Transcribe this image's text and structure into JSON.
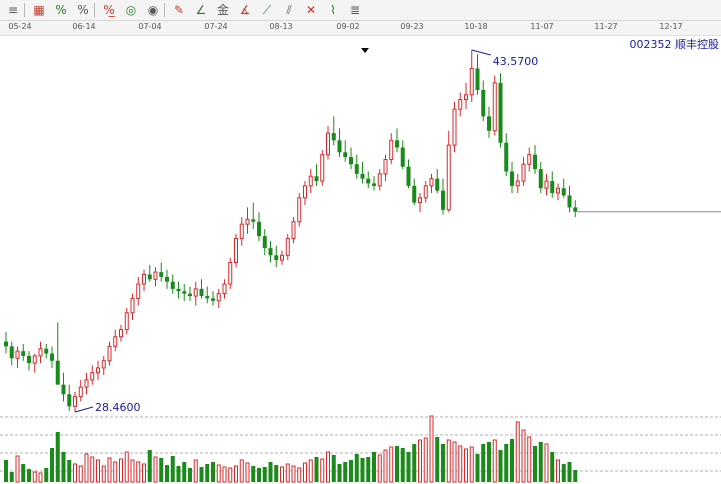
{
  "toolbar": {
    "icons": [
      "menu-lines-icon",
      "bar-table-icon",
      "percent-slash-icon",
      "percent-icon",
      "percent-line-icon",
      "coin-icon",
      "coin-line-icon",
      "pen-arrow-icon",
      "line-slope-icon",
      "gold-icon",
      "angle-line-icon",
      "fan-line-icon",
      "parallel-line-icon",
      "cross-line-icon",
      "stair-icon",
      "block-line-icon"
    ],
    "labels": [
      "≡",
      "▦",
      "%",
      "%",
      "%̲",
      "◎",
      "◉",
      "✎",
      "∠",
      "金",
      "∡",
      "⟋",
      "⫽",
      "✕",
      "⌇",
      "≣"
    ]
  },
  "stock_label": "002352 顺丰控股",
  "chart_data": {
    "type": "candlestick",
    "x_axis_ticks": [
      "05-24",
      "06-14",
      "07-04",
      "07-24",
      "08-13",
      "09-02",
      "09-23",
      "10-18",
      "11-07",
      "11-27",
      "12-17"
    ],
    "annotations": {
      "high_label": "43.5700",
      "low_label": "28.4600"
    },
    "last_close": 36.82,
    "candles": [
      [
        31.4,
        31.8,
        30.9,
        31.2
      ],
      [
        31.2,
        31.4,
        30.4,
        30.7
      ],
      [
        30.7,
        31.2,
        30.3,
        31.0
      ],
      [
        31.0,
        31.3,
        30.6,
        30.8
      ],
      [
        30.8,
        31.0,
        30.2,
        30.5
      ],
      [
        30.5,
        30.9,
        30.1,
        30.8
      ],
      [
        30.8,
        31.4,
        30.5,
        31.1
      ],
      [
        31.1,
        31.3,
        30.7,
        30.9
      ],
      [
        30.9,
        31.2,
        30.3,
        30.6
      ],
      [
        30.6,
        32.2,
        30.4,
        29.6
      ],
      [
        29.6,
        30.1,
        28.9,
        29.2
      ],
      [
        29.2,
        29.6,
        28.5,
        28.7
      ],
      [
        28.7,
        29.3,
        28.46,
        29.1
      ],
      [
        29.1,
        29.8,
        28.9,
        29.5
      ],
      [
        29.5,
        30.1,
        29.2,
        29.8
      ],
      [
        29.8,
        30.4,
        29.6,
        30.1
      ],
      [
        30.1,
        30.6,
        29.8,
        30.3
      ],
      [
        30.3,
        30.8,
        30.0,
        30.6
      ],
      [
        30.6,
        31.4,
        30.4,
        31.2
      ],
      [
        31.2,
        31.9,
        31.0,
        31.6
      ],
      [
        31.6,
        32.1,
        31.4,
        31.9
      ],
      [
        31.9,
        32.8,
        31.7,
        32.6
      ],
      [
        32.6,
        33.4,
        32.3,
        33.2
      ],
      [
        33.2,
        34.1,
        32.9,
        33.8
      ],
      [
        33.8,
        34.4,
        33.5,
        34.2
      ],
      [
        34.2,
        34.6,
        33.9,
        34.0
      ],
      [
        34.0,
        34.5,
        33.7,
        34.3
      ],
      [
        34.3,
        34.7,
        33.9,
        34.1
      ],
      [
        34.1,
        34.4,
        33.6,
        33.9
      ],
      [
        33.9,
        34.2,
        33.4,
        33.6
      ],
      [
        33.6,
        33.9,
        33.2,
        33.5
      ],
      [
        33.5,
        33.8,
        33.1,
        33.4
      ],
      [
        33.4,
        33.7,
        33.1,
        33.3
      ],
      [
        33.3,
        33.9,
        32.9,
        33.6
      ],
      [
        33.6,
        34.0,
        33.2,
        33.3
      ],
      [
        33.3,
        33.7,
        33.0,
        33.2
      ],
      [
        33.2,
        33.5,
        32.9,
        33.1
      ],
      [
        33.1,
        33.6,
        32.8,
        33.4
      ],
      [
        33.4,
        34.0,
        33.2,
        33.8
      ],
      [
        33.8,
        34.9,
        33.6,
        34.7
      ],
      [
        34.7,
        35.9,
        34.5,
        35.7
      ],
      [
        35.7,
        36.6,
        35.4,
        36.3
      ],
      [
        36.3,
        37.0,
        35.9,
        36.5
      ],
      [
        36.5,
        37.2,
        36.1,
        36.4
      ],
      [
        36.4,
        36.8,
        35.6,
        35.8
      ],
      [
        35.8,
        36.1,
        35.0,
        35.3
      ],
      [
        35.3,
        35.6,
        34.7,
        35.0
      ],
      [
        35.0,
        35.4,
        34.5,
        34.8
      ],
      [
        34.8,
        35.2,
        34.6,
        35.0
      ],
      [
        35.0,
        35.9,
        34.8,
        35.7
      ],
      [
        35.7,
        36.6,
        35.5,
        36.4
      ],
      [
        36.4,
        37.6,
        36.2,
        37.4
      ],
      [
        37.4,
        38.1,
        37.1,
        37.9
      ],
      [
        37.9,
        38.6,
        37.6,
        38.3
      ],
      [
        38.3,
        38.8,
        37.9,
        38.1
      ],
      [
        38.1,
        39.4,
        37.9,
        39.2
      ],
      [
        39.2,
        40.4,
        39.0,
        40.1
      ],
      [
        40.1,
        40.8,
        39.6,
        39.8
      ],
      [
        39.8,
        40.3,
        39.1,
        39.3
      ],
      [
        39.3,
        39.8,
        38.9,
        39.1
      ],
      [
        39.1,
        39.5,
        38.6,
        38.8
      ],
      [
        38.8,
        39.2,
        38.2,
        38.4
      ],
      [
        38.4,
        38.9,
        38.0,
        38.2
      ],
      [
        38.2,
        38.5,
        37.8,
        38.0
      ],
      [
        38.0,
        38.3,
        37.7,
        37.9
      ],
      [
        37.9,
        38.6,
        37.7,
        38.4
      ],
      [
        38.4,
        39.2,
        38.1,
        39.0
      ],
      [
        39.0,
        40.1,
        38.8,
        39.8
      ],
      [
        39.8,
        40.3,
        39.3,
        39.5
      ],
      [
        39.5,
        39.8,
        38.6,
        38.7
      ],
      [
        38.7,
        39.0,
        37.8,
        37.9
      ],
      [
        37.9,
        38.2,
        37.1,
        37.2
      ],
      [
        37.2,
        37.6,
        36.8,
        37.4
      ],
      [
        37.4,
        38.1,
        37.2,
        37.9
      ],
      [
        37.9,
        38.4,
        37.6,
        38.2
      ],
      [
        38.2,
        38.6,
        37.6,
        37.7
      ],
      [
        37.7,
        38.2,
        36.7,
        36.9
      ],
      [
        36.9,
        40.2,
        36.8,
        39.6
      ],
      [
        39.6,
        41.4,
        39.3,
        41.1
      ],
      [
        41.1,
        41.8,
        40.8,
        41.5
      ],
      [
        41.5,
        42.2,
        41.1,
        41.7
      ],
      [
        41.7,
        43.57,
        41.4,
        42.8
      ],
      [
        42.8,
        43.4,
        41.7,
        41.9
      ],
      [
        41.9,
        42.3,
        40.6,
        40.8
      ],
      [
        40.8,
        41.2,
        39.9,
        40.2
      ],
      [
        40.2,
        42.5,
        40.0,
        42.2
      ],
      [
        42.2,
        42.6,
        39.5,
        39.7
      ],
      [
        39.7,
        40.1,
        38.3,
        38.5
      ],
      [
        38.5,
        38.9,
        37.6,
        37.9
      ],
      [
        37.9,
        38.4,
        37.6,
        38.1
      ],
      [
        38.1,
        39.1,
        37.9,
        38.8
      ],
      [
        38.8,
        39.5,
        38.5,
        39.2
      ],
      [
        39.2,
        39.6,
        38.4,
        38.6
      ],
      [
        38.6,
        38.9,
        37.6,
        37.8
      ],
      [
        37.8,
        38.4,
        37.5,
        38.1
      ],
      [
        38.1,
        38.5,
        37.4,
        37.6
      ],
      [
        37.6,
        38.0,
        37.3,
        37.8
      ],
      [
        37.8,
        38.2,
        37.4,
        37.5
      ],
      [
        37.5,
        37.9,
        36.8,
        37.0
      ],
      [
        37.0,
        37.3,
        36.6,
        36.82
      ]
    ],
    "volume": [
      22,
      10,
      26,
      18,
      13,
      10,
      9,
      14,
      34,
      50,
      30,
      22,
      18,
      16,
      28,
      25,
      22,
      16,
      24,
      20,
      23,
      30,
      22,
      20,
      18,
      32,
      25,
      24,
      17,
      26,
      16,
      20,
      14,
      22,
      15,
      18,
      20,
      17,
      15,
      14,
      16,
      22,
      19,
      16,
      14,
      15,
      20,
      17,
      15,
      18,
      16,
      14,
      19,
      22,
      25,
      23,
      30,
      27,
      18,
      20,
      22,
      28,
      24,
      25,
      30,
      27,
      32,
      35,
      36,
      34,
      30,
      38,
      42,
      44,
      66,
      45,
      38,
      42,
      40,
      36,
      33,
      35,
      28,
      38,
      40,
      42,
      32,
      38,
      43,
      60,
      52,
      45,
      36,
      40,
      38,
      30,
      22,
      18,
      20,
      12
    ]
  }
}
